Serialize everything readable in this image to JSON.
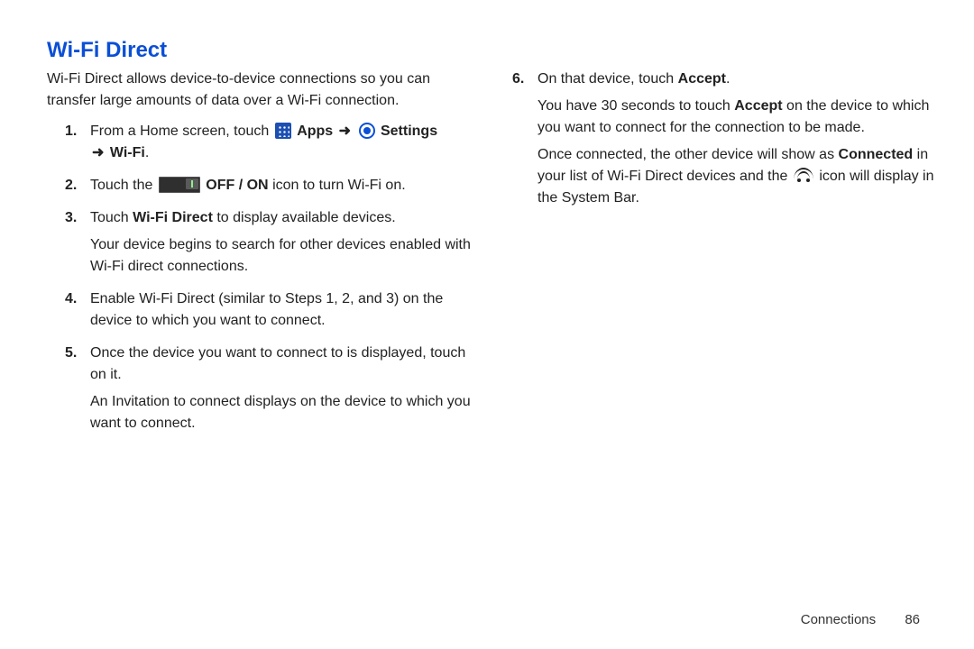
{
  "title": "Wi-Fi Direct",
  "arrow": "➜",
  "intro": "Wi-Fi Direct allows device-to-device connections so you can transfer large amounts of data over a Wi-Fi connection.",
  "steps": {
    "s1": {
      "num": "1.",
      "pre": "From a Home screen, touch ",
      "apps": "Apps",
      "settings": "Settings",
      "wifi": "Wi-Fi",
      "dot": "."
    },
    "s2": {
      "num": "2.",
      "pre": "Touch the ",
      "offOn": "OFF / ON",
      "post": " icon to turn Wi-Fi on."
    },
    "s3": {
      "num": "3.",
      "pre": "Touch ",
      "wfd": "Wi-Fi Direct",
      "post": " to display available devices.",
      "sub": "Your device begins to search for other devices enabled with Wi-Fi direct connections."
    },
    "s4": {
      "num": "4.",
      "text": "Enable Wi-Fi Direct (similar to Steps 1, 2, and 3) on the device to which you want to connect."
    },
    "s5": {
      "num": "5.",
      "text": "Once the device you want to connect to is displayed, touch on it.",
      "sub": "An Invitation to connect displays on the device to which you want to connect."
    },
    "s6": {
      "num": "6.",
      "pre": "On that device, touch ",
      "accept": "Accept",
      "dot": ".",
      "subPre": "You have 30 seconds to touch ",
      "subBold": "Accept",
      "subPost": " on the device to which you want to connect for the connection to be made.",
      "sub2Pre": "Once connected, the other device will show as ",
      "sub2Bold": "Connected",
      "sub2Mid": " in your list of Wi-Fi Direct devices and the ",
      "sub2Post": " icon will display in the System Bar."
    }
  },
  "footer": {
    "section": "Connections",
    "page": "86"
  }
}
